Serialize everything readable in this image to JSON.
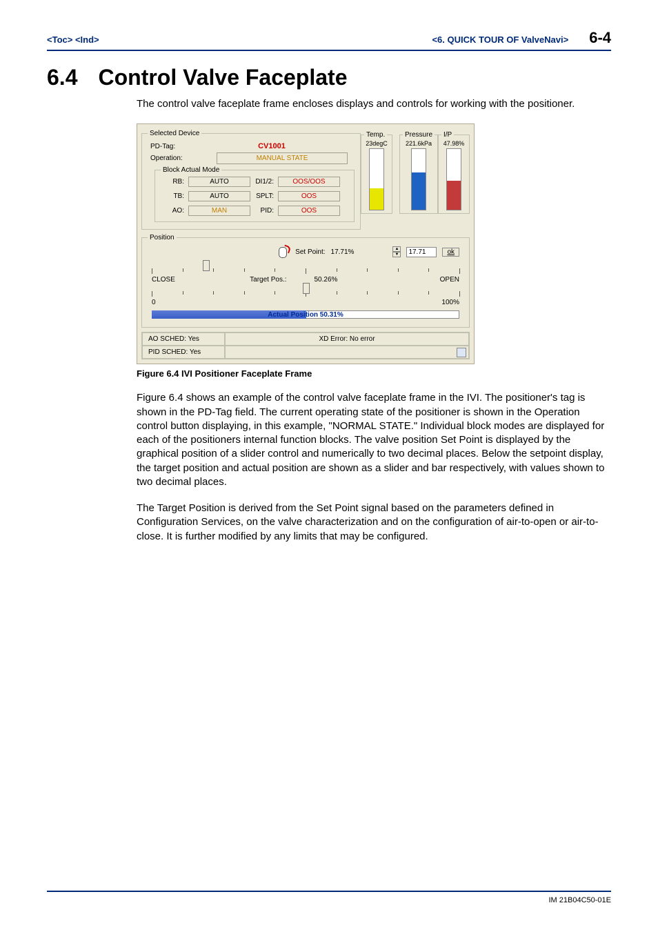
{
  "header": {
    "toc": "<Toc>",
    "ind": "<Ind>",
    "section_ref": "<6.  QUICK TOUR OF ValveNavi>",
    "page": "6-4"
  },
  "title": {
    "num": "6.4",
    "text": "Control Valve Faceplate"
  },
  "intro": "The control valve faceplate frame encloses displays and controls for working with the positioner.",
  "figure": {
    "selected_legend": "Selected Device",
    "pdtag_label": "PD-Tag:",
    "pdtag_value": "CV1001",
    "operation_label": "Operation:",
    "operation_value": "MANUAL STATE",
    "block_legend": "Block Actual Mode",
    "blocks": {
      "rb_label": "RB:",
      "rb_val": "AUTO",
      "tb_label": "TB:",
      "tb_val": "AUTO",
      "ao_label": "AO:",
      "ao_val": "MAN",
      "di_label": "DI1/2:",
      "di_val": "OOS/OOS",
      "splt_label": "SPLT:",
      "splt_val": "OOS",
      "pid_label": "PID:",
      "pid_val": "OOS"
    },
    "gauges": {
      "temp_legend": "Temp.",
      "temp_val": "23degC",
      "temp_fill": 35,
      "temp_color": "#e6e600",
      "press_legend": "Pressure",
      "press_val": "221.6kPa",
      "press_fill": 62,
      "press_color": "#1e62c4",
      "ip_legend": "I/P",
      "ip_val": "47.98%",
      "ip_fill": 48,
      "ip_color": "#c23a3a"
    },
    "position": {
      "legend": "Position",
      "setpoint_label": "Set Point:",
      "setpoint_val": "17.71%",
      "setpoint_input": "17.71",
      "ok": "ok",
      "close": "CLOSE",
      "open": "OPEN",
      "target_label": "Target Pos.:",
      "target_val": "50.26%",
      "zero": "0",
      "hundred": "100%",
      "actual_label": "Actual Position 50.31%",
      "setpoint_pos": 17.71,
      "target_pos": 50.26,
      "actual_pos": 50.31
    },
    "status": {
      "ao": "AO SCHED: Yes",
      "pid": "PID SCHED: Yes",
      "xd": "XD Error: No error"
    }
  },
  "caption": "Figure 6.4 IVI Positioner Faceplate Frame",
  "para1": "Figure 6.4 shows an example of the control valve faceplate frame in the IVI.  The positioner's tag is shown in the PD-Tag field.  The current operating state of the positioner is shown in the Operation control button displaying, in this example, \"NORMAL STATE.\" Individual block modes are displayed for each of the positioners internal function blocks.  The valve position Set Point is displayed by the graphical position of a slider control and numerically to two decimal places.  Below the setpoint display, the target position and actual position are shown as a slider and bar respectively, with values shown to two decimal places.",
  "para2": "The Target Position is derived from the Set Point signal based on the parameters defined in Configuration Services, on the valve characterization and on the configuration of air-to-open or air-to-close.  It is further modified by any limits that may be configured.",
  "footer": "IM 21B04C50-01E"
}
